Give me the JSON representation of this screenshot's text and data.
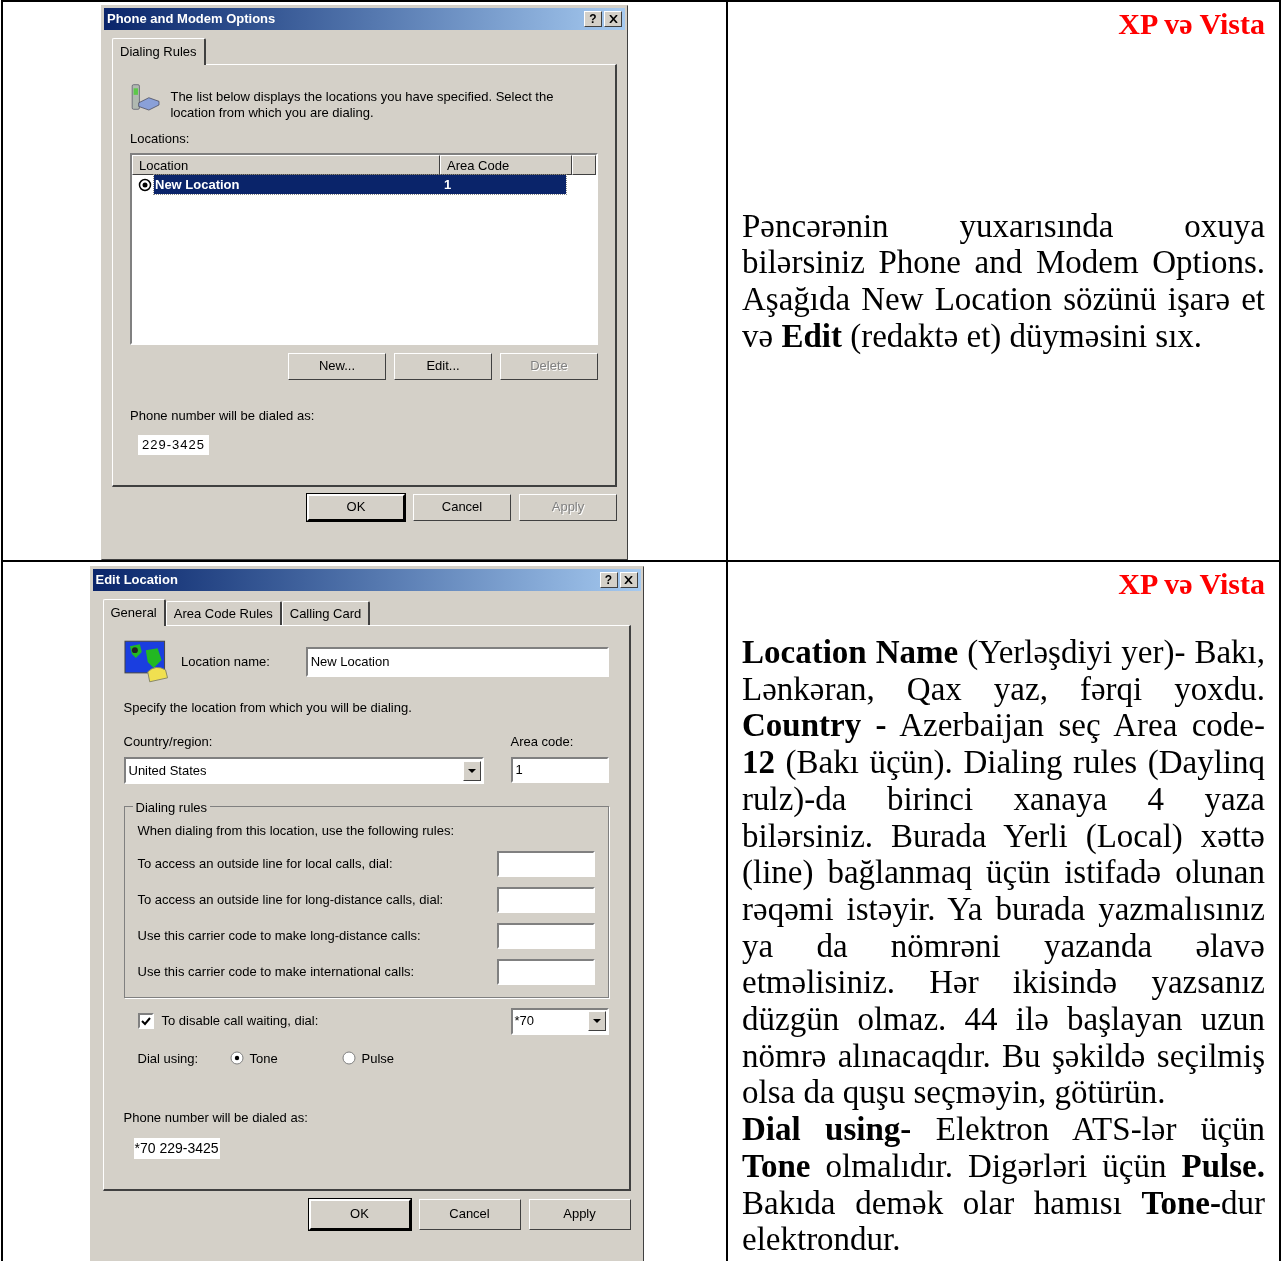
{
  "phone_modem_dialog": {
    "title": "Phone and Modem Options",
    "help_button": "?",
    "tabs": [
      {
        "label": "Dialing Rules",
        "selected": true
      }
    ],
    "intro": "The list below displays the locations you have specified. Select the location from which you are dialing.",
    "locations_label": "Locations:",
    "columns": [
      "Location",
      "Area Code"
    ],
    "rows": [
      {
        "location": "New Location",
        "area_code": "1",
        "selected": true
      }
    ],
    "list_buttons": [
      {
        "label": "New...",
        "disabled": false
      },
      {
        "label": "Edit...",
        "disabled": false
      },
      {
        "label": "Delete",
        "disabled": true
      }
    ],
    "dialed_as_label": "Phone number will be dialed as:",
    "dialed_as": "229-3425",
    "buttons": [
      {
        "label": "OK",
        "default": true,
        "disabled": false
      },
      {
        "label": "Cancel",
        "default": false,
        "disabled": false
      },
      {
        "label": "Apply",
        "default": false,
        "disabled": true
      }
    ]
  },
  "note_1": {
    "heading": "XP və Vista",
    "paragraphs": [
      "Pəncərənin yuxarısında oxuya bilərsiniz Phone and Modem Options. Aşağıda New Location sözünü işarə et və **Edit** (redaktə et) düyməsini sıx."
    ]
  },
  "edit_location_dialog": {
    "title": "Edit Location",
    "help_button": "?",
    "tabs": [
      {
        "label": "General",
        "selected": true
      },
      {
        "label": "Area Code Rules",
        "selected": false
      },
      {
        "label": "Calling Card",
        "selected": false
      }
    ],
    "location_name": {
      "label": "Location name:",
      "value": "New Location"
    },
    "instruction": "Specify the location from which you will be dialing.",
    "country": {
      "label": "Country/region:",
      "value": "United States"
    },
    "area_code": {
      "label": "Area code:",
      "value": "1"
    },
    "dialing_rules": {
      "title": "Dialing rules",
      "intro": "When dialing from this location, use the following rules:",
      "fields": [
        {
          "label": "To access an outside line for local calls, dial:"
        },
        {
          "label": "To access an outside line for long-distance calls, dial:"
        },
        {
          "label": "Use this carrier code to make long-distance calls:"
        },
        {
          "label": "Use this carrier code to make international calls:"
        }
      ]
    },
    "call_waiting": {
      "label": "To disable call waiting, dial:",
      "checked": true,
      "value": "*70"
    },
    "dial_using": {
      "label": "Dial using:",
      "options": [
        {
          "label": "Tone",
          "selected": true
        },
        {
          "label": "Pulse",
          "selected": false
        }
      ]
    },
    "dialed_as_label": "Phone number will be dialed as:",
    "dialed_as": "*70 229-3425",
    "buttons": [
      {
        "label": "OK",
        "default": true,
        "disabled": false
      },
      {
        "label": "Cancel",
        "default": false,
        "disabled": false
      },
      {
        "label": "Apply",
        "default": false,
        "disabled": false
      }
    ]
  },
  "note_2": {
    "heading": "XP və Vista",
    "paragraphs": [
      "**Location Name** (Yerləşdiyi yer)- Bakı, Lənkəran, Qax yaz, fərqi yoxdu. **Country -** Azerbaijan seç Area code- **12** (Bakı üçün). Dialing rules (Daylinq rulz)-da birinci xanaya 4 yaza bilərsiniz. Burada Yerli (Local) xəttə (line) bağlanmaq üçün istifadə olunan rəqəmi istəyir. Ya burada yazmalısınız ya da nömrəni yazanda əlavə etməlisiniz. Hər ikisində yazsanız düzgün olmaz. 44 ilə başlayan uzun nömrə alınacaqdır. Bu şəkildə seçilmiş olsa da quşu seçməyin, götürün.",
      "**Dial using-** Elektron ATS-lər üçün **Tone** olmalıdır. Digərləri üçün **Pulse.** Bakıda demək olar hamısı **Tone-**dur elektrondur."
    ]
  }
}
